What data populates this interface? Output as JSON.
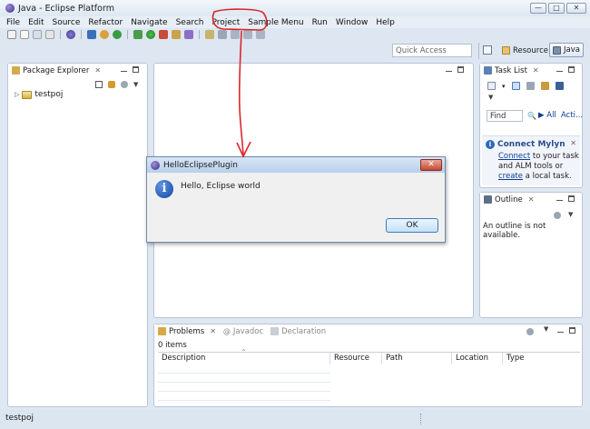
{
  "window": {
    "title": "Java - Eclipse Platform",
    "controls": [
      "—",
      "□",
      "✕"
    ]
  },
  "menubar": [
    "File",
    "Edit",
    "Source",
    "Refactor",
    "Navigate",
    "Search",
    "Project",
    "Sample Menu",
    "Run",
    "Window",
    "Help"
  ],
  "toolbar": {
    "quick_access_placeholder": "Quick Access",
    "perspectives": {
      "resource": "Resource",
      "java": "Java"
    }
  },
  "package_explorer": {
    "tab_label": "Package Explorer",
    "tree": [
      {
        "label": "testpoj"
      }
    ]
  },
  "task_list": {
    "tab_label": "Task List",
    "find_placeholder": "Find",
    "all_label": "All",
    "acti_label": "Acti...",
    "mylyn": {
      "title": "Connect Mylyn",
      "connect_link": "Connect",
      "text_1": " to your task and ALM tools or ",
      "create_link": "create",
      "text_2": " a local task."
    }
  },
  "outline": {
    "tab_label": "Outline",
    "message": "An outline is not available."
  },
  "problems": {
    "tabs": [
      "Problems",
      "Javadoc",
      "Declaration"
    ],
    "item_count": "0 items",
    "columns": [
      "Description",
      "Resource",
      "Path",
      "Location",
      "Type"
    ]
  },
  "status_bar": {
    "text": "testpoj"
  },
  "dialog": {
    "title": "HelloEclipsePlugin",
    "message": "Hello, Eclipse world",
    "ok_label": "OK"
  },
  "colors": {
    "annotation": "#d9272c",
    "link": "#0b3d91"
  }
}
